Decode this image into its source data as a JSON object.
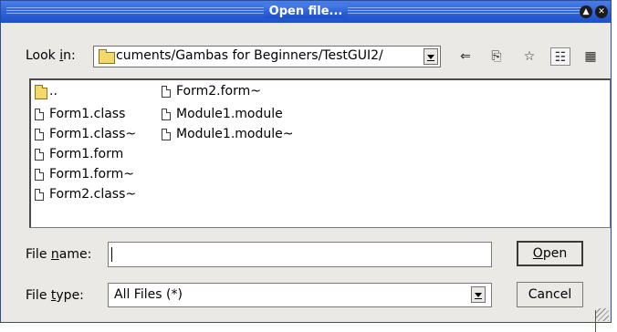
{
  "window": {
    "title": "Open file..."
  },
  "look_in": {
    "label_pre": "Look ",
    "label_u": "i",
    "label_post": "n:",
    "path": "cuments/Gambas for Beginners/TestGUI2/"
  },
  "toolbar": {
    "icons": [
      "back-arrow-icon",
      "parent-folder-icon",
      "new-folder-icon",
      "detail-view-icon",
      "list-view-icon"
    ]
  },
  "files": {
    "column1": [
      "..",
      "Form1.class",
      "Form1.class~",
      "Form1.form",
      "Form1.form~",
      "Form2.class~"
    ],
    "column2": [
      "Form2.form~",
      "Module1.module",
      "Module1.module~"
    ]
  },
  "file_name": {
    "label_pre": "File ",
    "label_u": "n",
    "label_post": "ame:",
    "value": ""
  },
  "file_type": {
    "label_pre": "File ",
    "label_u": "t",
    "label_post": "ype:",
    "selected": "All Files (*)"
  },
  "buttons": {
    "open_u": "O",
    "open_rest": "pen",
    "cancel": "Cancel"
  }
}
